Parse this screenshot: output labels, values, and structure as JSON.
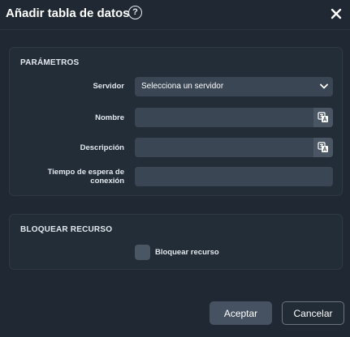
{
  "dialog": {
    "title": "Añadir tabla de datos",
    "help_icon": "question-circle-icon",
    "help_glyph": "?",
    "close_icon": "close-icon"
  },
  "parameters": {
    "title": "PARÁMETROS",
    "server_label": "Servidor",
    "server_value": "Selecciona un servidor",
    "name_label": "Nombre",
    "name_value": "",
    "description_label": "Descripción",
    "description_value": "",
    "timeout_label": "Tiempo de espera de conexión",
    "timeout_value": "",
    "input_action_icon": "translate-icon"
  },
  "lock": {
    "title": "BLOQUEAR RECURSO",
    "checkbox_label": "Bloquear recurso",
    "checked": false
  },
  "footer": {
    "accept_label": "Aceptar",
    "cancel_label": "Cancelar"
  },
  "colors": {
    "background": "#1f2833",
    "panel": "#232d38",
    "input": "#3a4653",
    "accent_button": "#465261"
  }
}
